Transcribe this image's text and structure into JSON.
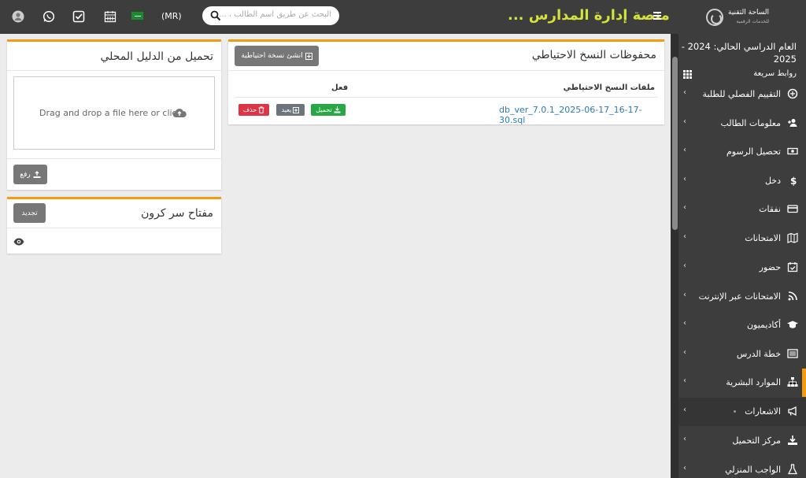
{
  "topbar": {
    "lang_label": "(MR)",
    "search_placeholder": "البحث عن طريق اسم الطالب ، ...",
    "app_title": "منصة إدارة المدارس ...",
    "logo_title": "الساحة التقنية",
    "logo_subtitle": "للخدمات الرقمية",
    "icons": [
      "user-icon",
      "whatsapp-icon",
      "checklist-icon",
      "calendar-icon",
      "flag-icon",
      "search-icon",
      "hamburger-icon"
    ]
  },
  "sidebar": {
    "academic_year": "العام الدراسي الحالي: 2024 - 2025",
    "quick_links": "روابط سريعة",
    "items": [
      {
        "label": "التقييم الفصلي للطلبة",
        "icon": "grade-icon"
      },
      {
        "label": "معلومات الطالب",
        "icon": "user-plus-icon"
      },
      {
        "label": "تحصيل الرسوم",
        "icon": "money-icon"
      },
      {
        "label": "دخل",
        "icon": "dollar-icon"
      },
      {
        "label": "نفقات",
        "icon": "credit-card-icon"
      },
      {
        "label": "الامتحانات",
        "icon": "map-icon"
      },
      {
        "label": "حضور",
        "icon": "calendar-check-icon"
      },
      {
        "label": "الامتحانات عبر الإنترنت",
        "icon": "rss-icon"
      },
      {
        "label": "أكاديميون",
        "icon": "graduation-cap-icon"
      },
      {
        "label": "خطة الدرس",
        "icon": "list-icon"
      },
      {
        "label": "الموارد البشرية",
        "icon": "sitemap-icon"
      },
      {
        "label": "الاشعارات",
        "icon": "bullhorn-icon"
      },
      {
        "label": "مركز التحميل",
        "icon": "download-icon"
      },
      {
        "label": "الواجب المنزلي",
        "icon": "flask-icon"
      }
    ]
  },
  "backup_panel": {
    "title": "محفوظات النسخ الاحتياطي",
    "create_button": "انشئ نسخة احتياطية",
    "col_files": "ملفات النسخ الاحتياطي",
    "col_action": "فعل",
    "rows": [
      {
        "file": "db_ver_7.0.1_2025-06-17_16-17-30.sql",
        "download": "تحميل",
        "restore": "يعيد",
        "delete": "حذف"
      }
    ]
  },
  "upload_panel": {
    "title": "تحميل من الدليل المحلي",
    "drop_text": "Drag and drop a file here or click",
    "upload_button": "رفع"
  },
  "cron_panel": {
    "title": "مفتاح سر كرون",
    "renew_button": "تجديد"
  },
  "colors": {
    "accent": "#f39c12",
    "title_green": "#d4e23a",
    "download": "#28a745",
    "delete": "#dc3545",
    "restore": "#6c757d",
    "link": "#2a7bb0"
  }
}
